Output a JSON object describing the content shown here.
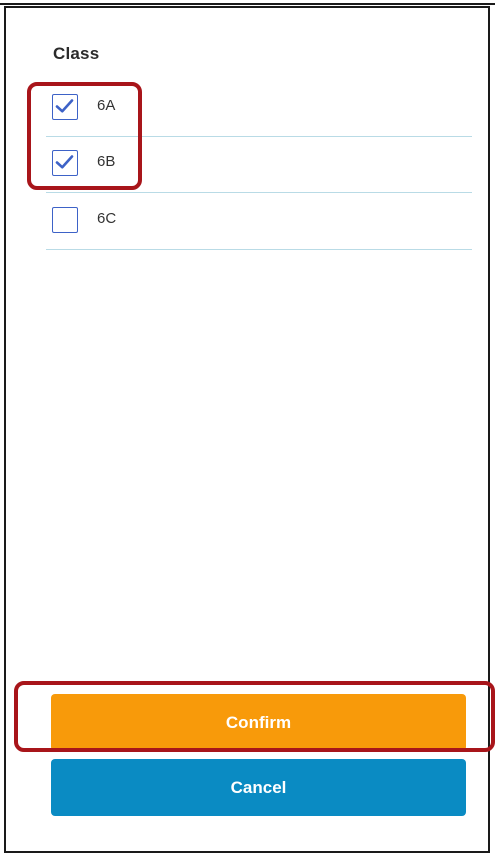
{
  "filter": {
    "title": "Class",
    "options": [
      {
        "label": "6A",
        "checked": true
      },
      {
        "label": "6B",
        "checked": true
      },
      {
        "label": "6C",
        "checked": false
      }
    ]
  },
  "actions": {
    "confirm_label": "Confirm",
    "cancel_label": "Cancel"
  },
  "colors": {
    "checkbox_border": "#3d62c7",
    "row_divider": "#b9dbe6",
    "confirm": "#f89a0a",
    "cancel": "#0a8bc3",
    "highlight": "#a8151a"
  },
  "icons": {
    "checked": "checkmark-icon"
  }
}
